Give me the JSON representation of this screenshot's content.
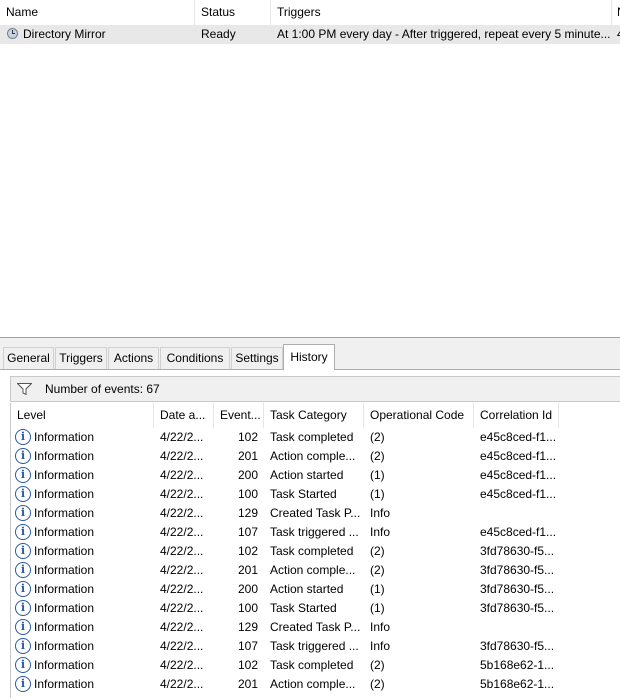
{
  "task_list": {
    "columns": [
      {
        "label": "Name"
      },
      {
        "label": "Status"
      },
      {
        "label": "Triggers"
      },
      {
        "label": "N"
      }
    ],
    "task": {
      "icon": "clock-icon",
      "name": "Directory Mirror",
      "status": "Ready",
      "triggers": "At 1:00 PM every day - After triggered, repeat every 5 minute...",
      "extra": "4"
    }
  },
  "tabs": [
    {
      "label": "General",
      "active": false
    },
    {
      "label": "Triggers",
      "active": false
    },
    {
      "label": "Actions",
      "active": false
    },
    {
      "label": "Conditions",
      "active": false
    },
    {
      "label": "Settings",
      "active": false
    },
    {
      "label": "History",
      "active": true
    }
  ],
  "history": {
    "filter_icon": "filter-icon",
    "events_label": "Number of events: 67",
    "columns": [
      {
        "label": "Level"
      },
      {
        "label": "Date a..."
      },
      {
        "label": "Event..."
      },
      {
        "label": "Task Category"
      },
      {
        "label": "Operational Code"
      },
      {
        "label": "Correlation Id"
      }
    ],
    "rows": [
      {
        "level": "Information",
        "date": "4/22/2...",
        "event_id": "102",
        "category": "Task completed",
        "op_code": "(2)",
        "correlation": "e45c8ced-f1..."
      },
      {
        "level": "Information",
        "date": "4/22/2...",
        "event_id": "201",
        "category": "Action comple...",
        "op_code": "(2)",
        "correlation": "e45c8ced-f1..."
      },
      {
        "level": "Information",
        "date": "4/22/2...",
        "event_id": "200",
        "category": "Action started",
        "op_code": "(1)",
        "correlation": "e45c8ced-f1..."
      },
      {
        "level": "Information",
        "date": "4/22/2...",
        "event_id": "100",
        "category": "Task Started",
        "op_code": "(1)",
        "correlation": "e45c8ced-f1..."
      },
      {
        "level": "Information",
        "date": "4/22/2...",
        "event_id": "129",
        "category": "Created Task P...",
        "op_code": "Info",
        "correlation": ""
      },
      {
        "level": "Information",
        "date": "4/22/2...",
        "event_id": "107",
        "category": "Task triggered ...",
        "op_code": "Info",
        "correlation": "e45c8ced-f1..."
      },
      {
        "level": "Information",
        "date": "4/22/2...",
        "event_id": "102",
        "category": "Task completed",
        "op_code": "(2)",
        "correlation": "3fd78630-f5..."
      },
      {
        "level": "Information",
        "date": "4/22/2...",
        "event_id": "201",
        "category": "Action comple...",
        "op_code": "(2)",
        "correlation": "3fd78630-f5..."
      },
      {
        "level": "Information",
        "date": "4/22/2...",
        "event_id": "200",
        "category": "Action started",
        "op_code": "(1)",
        "correlation": "3fd78630-f5..."
      },
      {
        "level": "Information",
        "date": "4/22/2...",
        "event_id": "100",
        "category": "Task Started",
        "op_code": "(1)",
        "correlation": "3fd78630-f5..."
      },
      {
        "level": "Information",
        "date": "4/22/2...",
        "event_id": "129",
        "category": "Created Task P...",
        "op_code": "Info",
        "correlation": ""
      },
      {
        "level": "Information",
        "date": "4/22/2...",
        "event_id": "107",
        "category": "Task triggered ...",
        "op_code": "Info",
        "correlation": "3fd78630-f5..."
      },
      {
        "level": "Information",
        "date": "4/22/2...",
        "event_id": "102",
        "category": "Task completed",
        "op_code": "(2)",
        "correlation": "5b168e62-1..."
      },
      {
        "level": "Information",
        "date": "4/22/2...",
        "event_id": "201",
        "category": "Action comple...",
        "op_code": "(2)",
        "correlation": "5b168e62-1..."
      }
    ]
  },
  "colors": {
    "selected_row": "#e8e8e8",
    "info_icon": "#2a5aa8",
    "panel_bg": "#f0f0f0"
  }
}
